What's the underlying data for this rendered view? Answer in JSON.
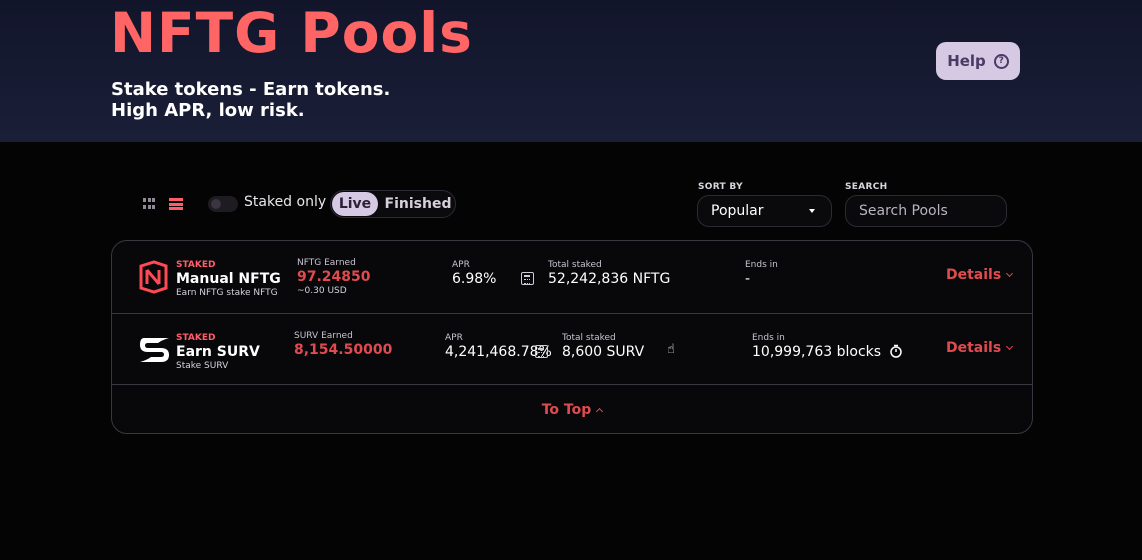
{
  "header": {
    "title": "NFTG Pools",
    "subtitle_line1": "Stake tokens - Earn tokens.",
    "subtitle_line2": "High APR, low risk.",
    "help_label": "Help",
    "help_icon": "question-circle-icon"
  },
  "toolbar": {
    "view_icons": [
      "grid-view-icon",
      "list-view-icon"
    ],
    "staked_only_label": "Staked only",
    "tabs": [
      {
        "label": "Live",
        "active": true
      },
      {
        "label": "Finished",
        "active": false
      }
    ],
    "sort_label": "SORT BY",
    "sort_value": "Popular",
    "search_label": "SEARCH",
    "search_placeholder": "Search Pools"
  },
  "pools": [
    {
      "tag": "STAKED",
      "name": "Manual NFTG",
      "desc": "Earn NFTG stake NFTG",
      "earned_label": "NFTG Earned",
      "earned_value": "97.24850",
      "earned_usd": "~0.30 USD",
      "apr_label": "APR",
      "apr_value": "6.98%",
      "total_label": "Total staked",
      "total_value": "52,242,836 NFTG",
      "ends_label": "Ends in",
      "ends_value": "-",
      "details_label": "Details"
    },
    {
      "tag": "STAKED",
      "name": "Earn SURV",
      "desc": "Stake SURV",
      "earned_label": "SURV Earned",
      "earned_value": "8,154.50000",
      "apr_label": "APR",
      "apr_value": "4,241,468.78%",
      "total_label": "Total staked",
      "total_value": "8,600 SURV",
      "ends_label": "Ends in",
      "ends_value": "10,999,763 blocks",
      "details_label": "Details"
    }
  ],
  "footer": {
    "to_top_label": "To Top"
  },
  "colors": {
    "accent": "#e04b4f",
    "title": "#ff6565",
    "help_bg": "#d6c9e3",
    "hero_bg": "#1a1f38",
    "page_bg": "#050405"
  }
}
